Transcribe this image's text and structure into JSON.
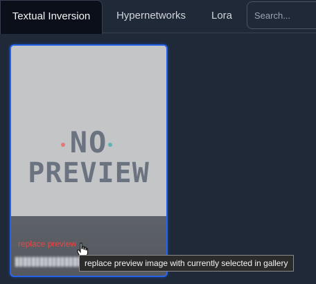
{
  "tabs": [
    {
      "label": "Textual Inversion",
      "active": true
    },
    {
      "label": "Hypernetworks",
      "active": false
    },
    {
      "label": "Lora",
      "active": false
    }
  ],
  "search": {
    "placeholder": "Search..."
  },
  "card": {
    "preview_line1": "NO",
    "preview_line2": "PREVIEW",
    "replace_link": "replace preview"
  },
  "tooltip": {
    "text": "replace preview image with currently selected in gallery"
  },
  "colors": {
    "accent": "#2563eb",
    "link": "#ef4444",
    "background": "#1f2937"
  }
}
